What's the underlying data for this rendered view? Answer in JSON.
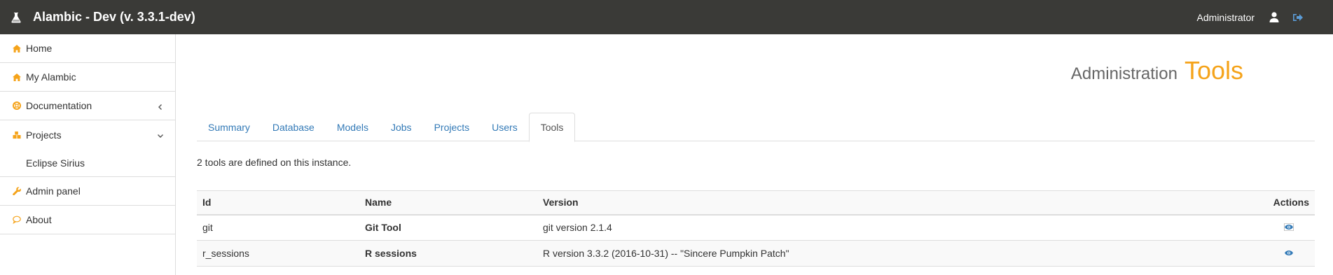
{
  "header": {
    "title": "Alambic - Dev (v. 3.3.1-dev)",
    "user": "Administrator",
    "brand_color": "#3a3a37"
  },
  "sidebar": {
    "items": [
      {
        "label": "Home",
        "icon": "home-icon"
      },
      {
        "label": "My Alambic",
        "icon": "home-icon"
      },
      {
        "label": "Documentation",
        "icon": "lifebuoy-icon",
        "caret": "chevron-left"
      },
      {
        "label": "Projects",
        "icon": "cubes-icon",
        "caret": "chevron-down"
      },
      {
        "label": "Eclipse Sirius",
        "sub": true
      },
      {
        "label": "Admin panel",
        "icon": "wrench-icon"
      },
      {
        "label": "About",
        "icon": "comment-icon"
      }
    ],
    "icon_color": "#f5a31a"
  },
  "page": {
    "title_prefix": "Administration",
    "title_main": "Tools",
    "accent": "#f5a31a"
  },
  "tabs": [
    {
      "label": "Summary"
    },
    {
      "label": "Database"
    },
    {
      "label": "Models"
    },
    {
      "label": "Jobs"
    },
    {
      "label": "Projects"
    },
    {
      "label": "Users"
    },
    {
      "label": "Tools",
      "active": true
    }
  ],
  "summary": "2 tools are defined on this instance.",
  "table": {
    "headers": {
      "id": "Id",
      "name": "Name",
      "version": "Version",
      "actions": "Actions"
    },
    "rows": [
      {
        "id": "git",
        "name": "Git Tool",
        "version": "git version 2.1.4",
        "action_icon": "eye-icon"
      },
      {
        "id": "r_sessions",
        "name": "R sessions",
        "version": "R version 3.3.2 (2016-10-31) -- \"Sincere Pumpkin Patch\"",
        "action_icon": "eye-icon"
      }
    ]
  }
}
